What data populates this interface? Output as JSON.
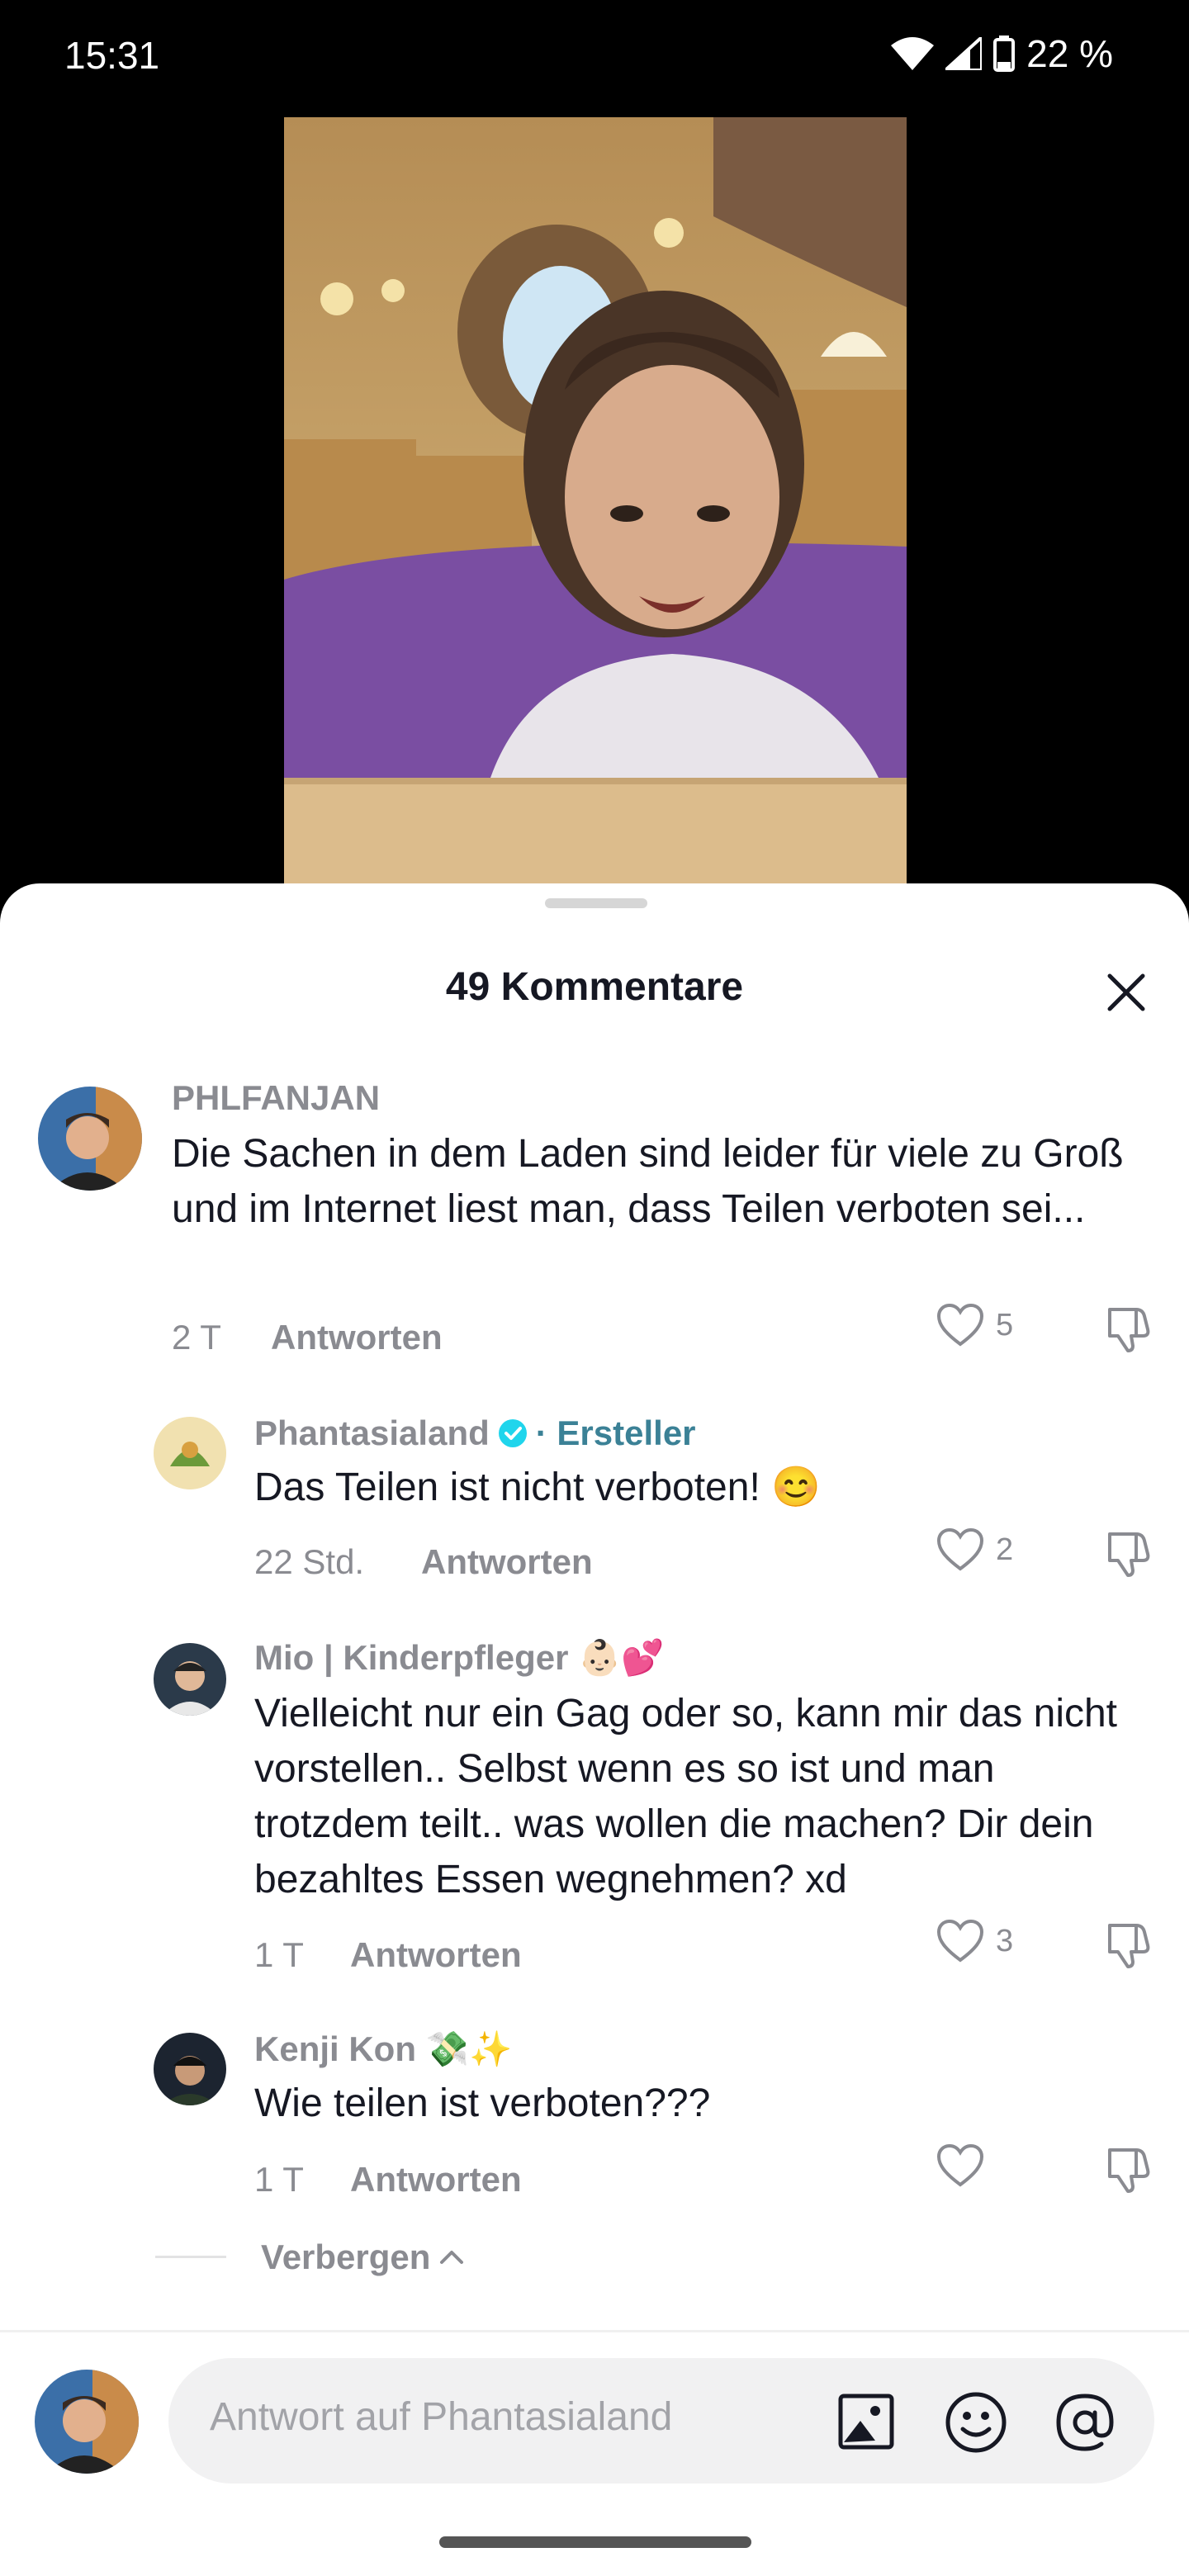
{
  "status_bar": {
    "time": "15:31",
    "battery": "22 %"
  },
  "sheet": {
    "title": "49 Kommentare"
  },
  "comments": [
    {
      "username": "PHLFANJAN",
      "text": "Die Sachen in dem Laden sind leider für viele zu Groß und im Internet liest man, dass Teilen verboten sei...",
      "time": "2 T",
      "reply_label": "Antworten",
      "likes": "5"
    },
    {
      "username": "Phantasialand",
      "creator_tag": "· Ersteller",
      "text": "Das Teilen ist nicht verboten! 😊",
      "time": "22 Std.",
      "reply_label": "Antworten",
      "likes": "2"
    },
    {
      "username": "Mio | Kinderpfleger 👶🏻💕",
      "text": "Vielleicht nur ein Gag oder so, kann mir das nicht vorstellen.. Selbst wenn es so ist und man trotzdem teilt.. was wollen die machen? Dir dein bezahltes Essen wegnehmen? xd",
      "time": "1 T",
      "reply_label": "Antworten",
      "likes": "3"
    },
    {
      "username": "Kenji Kon 💸✨",
      "text": "Wie teilen ist verboten???",
      "time": "1 T",
      "reply_label": "Antworten",
      "likes": ""
    }
  ],
  "hide_replies": "Verbergen",
  "input": {
    "placeholder": "Antwort auf Phantasialand"
  },
  "colors": {
    "creator": "#3b8196",
    "verified": "#20d5ec",
    "muted": "#8a8b91",
    "text": "#161823"
  },
  "icons": [
    "heart-icon",
    "dislike-icon",
    "verified-icon",
    "close-icon",
    "image-icon",
    "emoji-icon",
    "mention-icon",
    "chevron-up-icon",
    "wifi-icon",
    "signal-icon",
    "battery-icon"
  ]
}
